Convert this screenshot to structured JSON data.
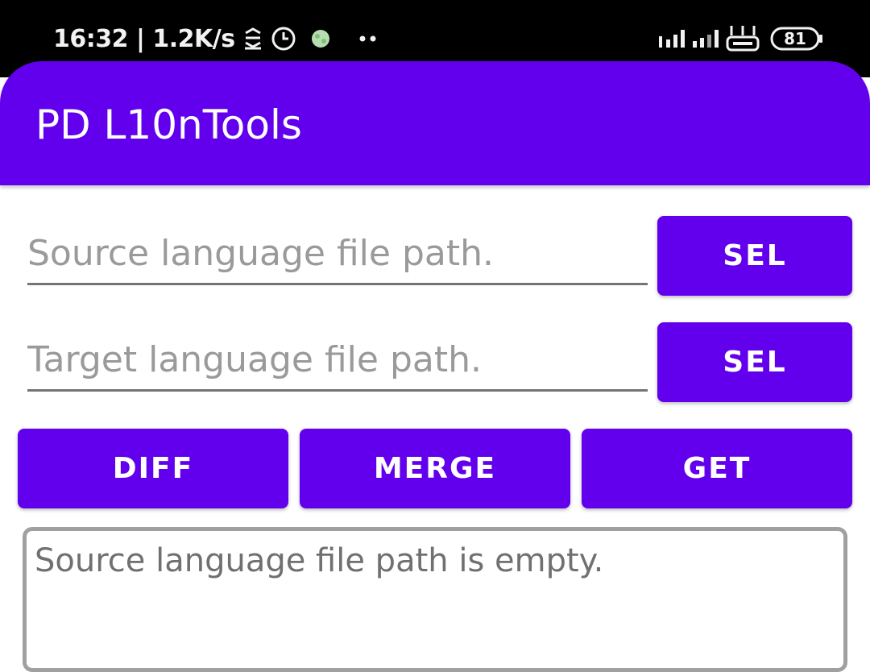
{
  "status_bar": {
    "time_speed": "16:32 | 1.2K/s",
    "battery_level": "81",
    "icons": [
      "data-saver-icon",
      "alarm-clock-icon",
      "notification-app-icon",
      "more-dots-icon",
      "signal-icon",
      "signal-icon",
      "router-icon",
      "battery-icon"
    ]
  },
  "app_bar": {
    "title": "PD L10nTools",
    "color": "#6200ee"
  },
  "form": {
    "source_placeholder": "Source language file path.",
    "source_value": "",
    "source_button": "SEL",
    "target_placeholder": "Target language file path.",
    "target_value": "",
    "target_button": "SEL"
  },
  "actions": {
    "diff": "DIFF",
    "merge": "MERGE",
    "get": "GET"
  },
  "output": {
    "message": "Source language file path is empty."
  }
}
